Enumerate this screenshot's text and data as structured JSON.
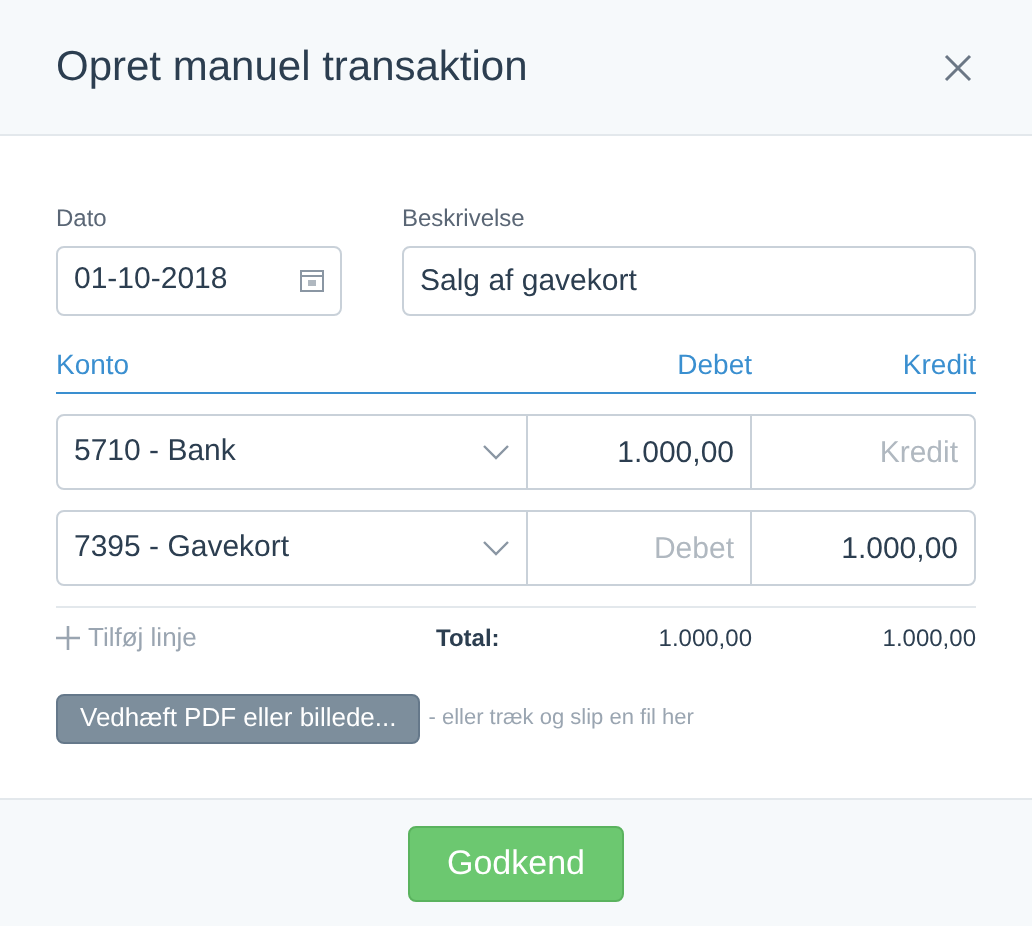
{
  "dialog": {
    "title": "Opret manuel transaktion"
  },
  "date": {
    "label": "Dato",
    "value": "01-10-2018"
  },
  "description": {
    "label": "Beskrivelse",
    "value": "Salg af gavekort"
  },
  "columns": [
    "Konto",
    "Debet",
    "Kredit"
  ],
  "lines": [
    {
      "account": "5710 - Bank",
      "debit": {
        "value": "1.000,00"
      },
      "credit": {
        "placeholder": "Kredit"
      }
    },
    {
      "account": "7395 - Gavekort",
      "debit": {
        "placeholder": "Debet"
      },
      "credit": {
        "value": "1.000,00"
      }
    }
  ],
  "add_line": "Tilføj linje",
  "total": {
    "label": "Total:",
    "debit": "1.000,00",
    "credit": "1.000,00"
  },
  "attach": {
    "button": "Vedhæft PDF eller billede...",
    "hint": "- eller træk og slip en fil her"
  },
  "confirm_button": "Godkend"
}
